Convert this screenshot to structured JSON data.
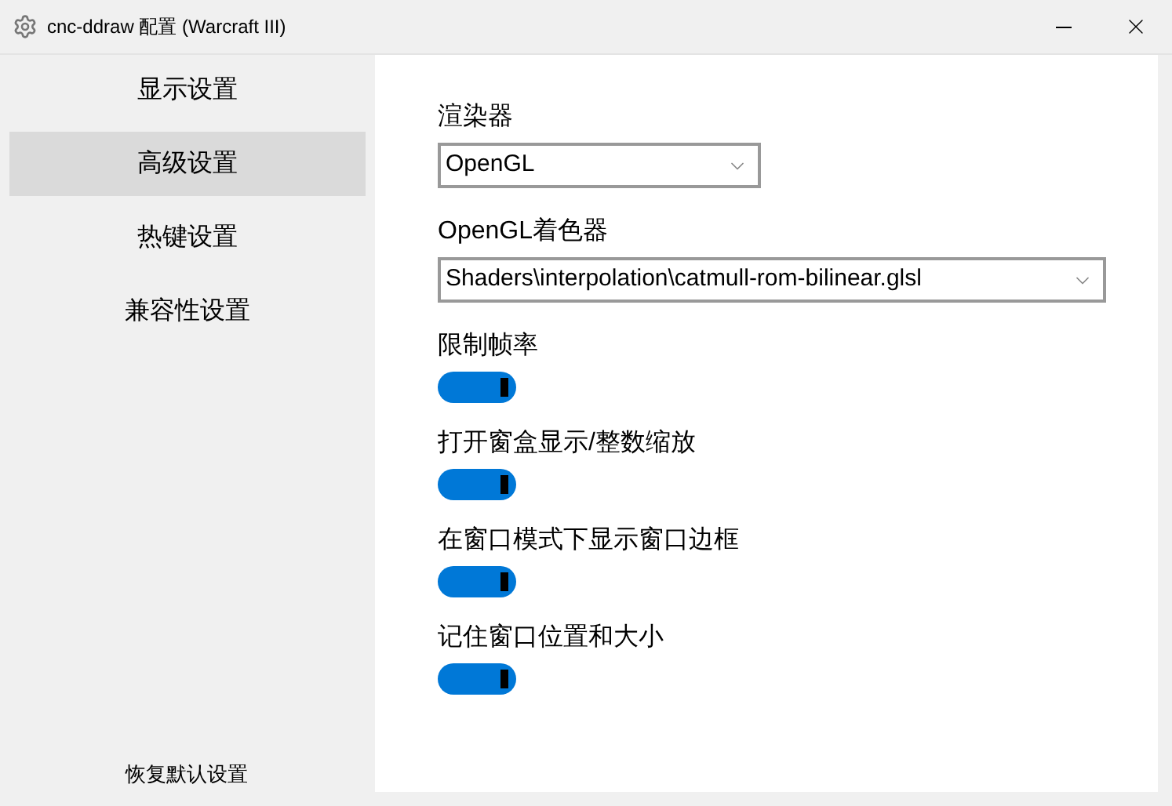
{
  "window": {
    "title": "cnc-ddraw 配置 (Warcraft III)"
  },
  "sidebar": {
    "items": [
      {
        "label": "显示设置",
        "selected": false
      },
      {
        "label": "高级设置",
        "selected": true
      },
      {
        "label": "热键设置",
        "selected": false
      },
      {
        "label": "兼容性设置",
        "selected": false
      }
    ],
    "reset_link": "恢复默认设置"
  },
  "settings": [
    {
      "kind": "dropdown",
      "label": "渲染器",
      "value": "OpenGL",
      "wide": false
    },
    {
      "kind": "dropdown",
      "label": "OpenGL着色器",
      "value": "Shaders\\interpolation\\catmull-rom-bilinear.glsl",
      "wide": true
    },
    {
      "kind": "toggle",
      "label": "限制帧率",
      "on": true
    },
    {
      "kind": "toggle",
      "label": "打开窗盒显示/整数缩放",
      "on": true
    },
    {
      "kind": "toggle",
      "label": "在窗口模式下显示窗口边框",
      "on": true
    },
    {
      "kind": "toggle",
      "label": "记住窗口位置和大小",
      "on": true
    }
  ]
}
